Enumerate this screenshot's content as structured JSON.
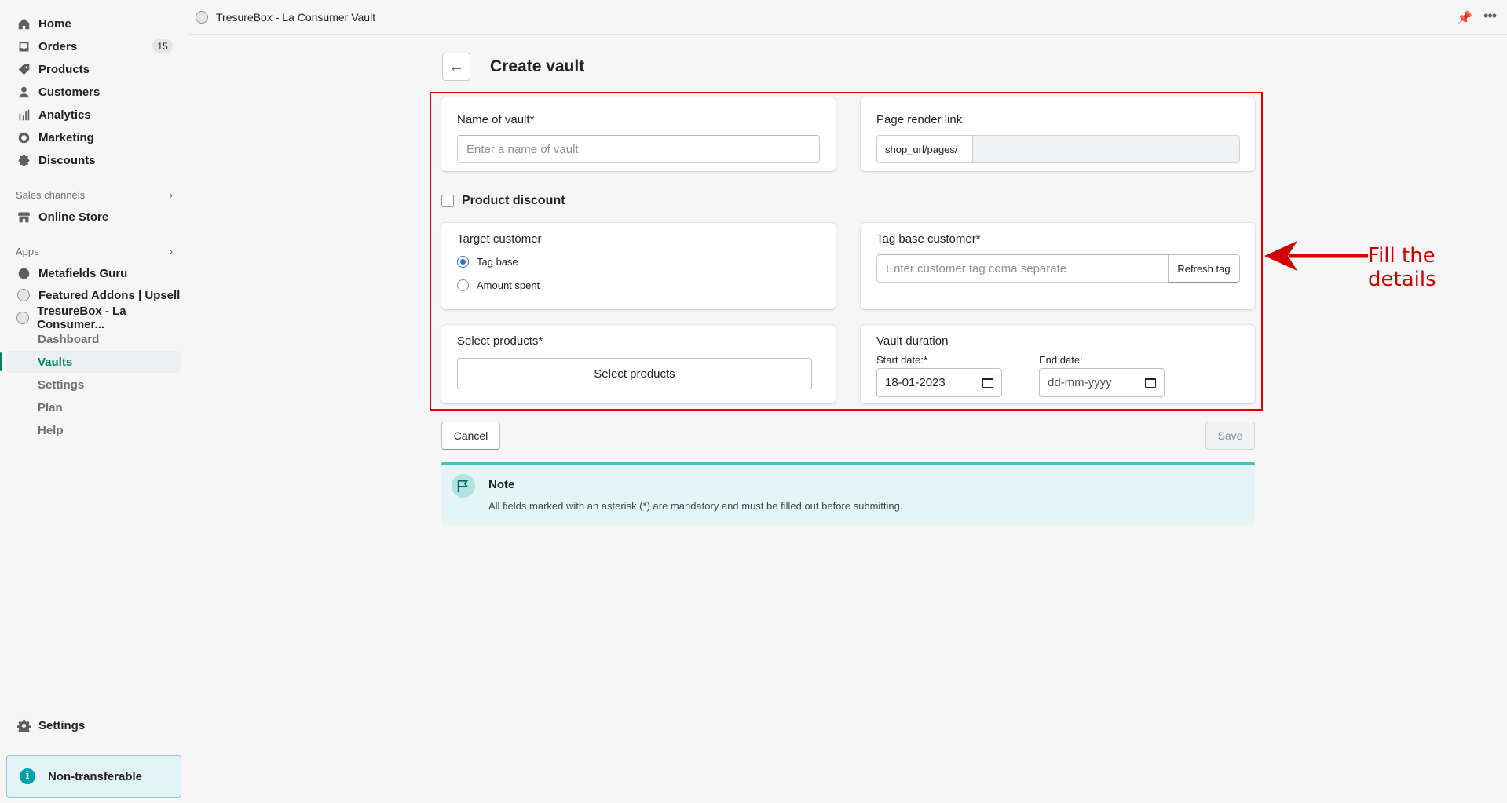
{
  "topbar": {
    "title": "TresureBox - La Consumer Vault"
  },
  "sidebar": {
    "nav": [
      {
        "label": "Home",
        "icon": "home-icon"
      },
      {
        "label": "Orders",
        "icon": "orders-icon",
        "badge": "15"
      },
      {
        "label": "Products",
        "icon": "tag-icon"
      },
      {
        "label": "Customers",
        "icon": "person-icon"
      },
      {
        "label": "Analytics",
        "icon": "bar-chart-icon"
      },
      {
        "label": "Marketing",
        "icon": "target-icon"
      },
      {
        "label": "Discounts",
        "icon": "discount-icon"
      }
    ],
    "sales_channels_heading": "Sales channels",
    "online_store": "Online Store",
    "apps_heading": "Apps",
    "apps": [
      "Metafields Guru",
      "Featured Addons | Upsell",
      "TresureBox - La Consumer..."
    ],
    "app_sub": [
      "Dashboard",
      "Vaults",
      "Settings",
      "Plan",
      "Help"
    ],
    "active_sub": "Vaults",
    "settings": "Settings",
    "non_transferable": "Non-transferable"
  },
  "page": {
    "title": "Create vault",
    "name_label": "Name of vault*",
    "name_placeholder": "Enter a name of vault",
    "page_render_label": "Page render link",
    "page_render_prefix": "shop_url/pages/",
    "product_discount_label": "Product discount",
    "target_customer_label": "Target customer",
    "radio_tag_base": "Tag base",
    "radio_amount_spent": "Amount spent",
    "tag_base_label": "Tag base customer*",
    "tag_placeholder": "Enter customer tag coma separate",
    "refresh_tag": "Refresh tag",
    "select_products_label": "Select products*",
    "select_products_button": "Select products",
    "vault_duration_label": "Vault duration",
    "start_date_label": "Start date:*",
    "start_date_value": "18-01-2023",
    "end_date_label": "End date:",
    "end_date_placeholder": "dd-mm-yyyy",
    "cancel": "Cancel",
    "save": "Save",
    "note_title": "Note",
    "note_text": "All fields marked with an asterisk (*) are mandatory and must be filled out before submitting."
  },
  "annotation": {
    "text": "Fill the details",
    "color": "#d00000"
  },
  "colors": {
    "accent": "#007f5f",
    "radio": "#2c6ecb",
    "note_border": "#47c1bf"
  }
}
